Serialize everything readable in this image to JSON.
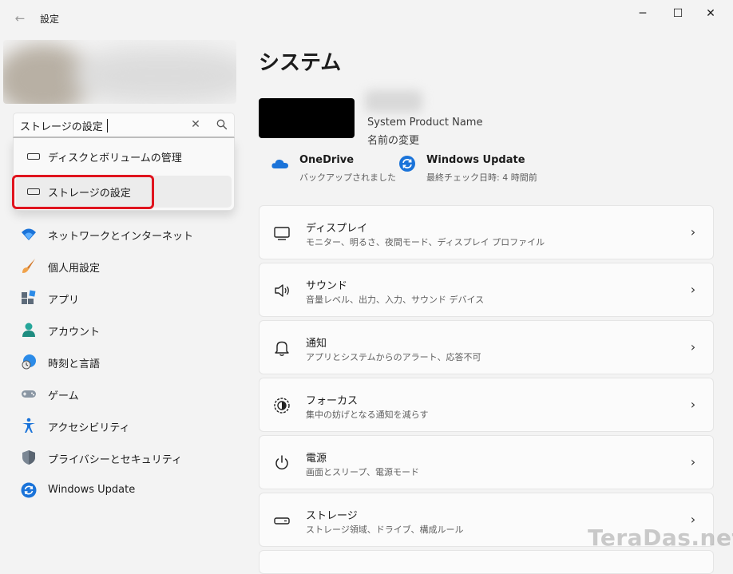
{
  "window": {
    "title": "設定",
    "back_glyph": "←",
    "minimize_glyph": "─",
    "maximize_glyph": "☐",
    "close_glyph": "✕"
  },
  "search": {
    "value": "ストレージの設定",
    "clear_glyph": "✕",
    "suggestions": [
      {
        "label": "ディスクとボリュームの管理",
        "icon": "storage-icon"
      },
      {
        "label": "ストレージの設定",
        "icon": "storage-icon",
        "highlighted": true
      }
    ]
  },
  "sidebar": {
    "items": [
      {
        "label": "ネットワークとインターネット",
        "icon": "wifi-icon"
      },
      {
        "label": "個人用設定",
        "icon": "brush-icon"
      },
      {
        "label": "アプリ",
        "icon": "apps-icon"
      },
      {
        "label": "アカウント",
        "icon": "person-icon"
      },
      {
        "label": "時刻と言語",
        "icon": "globe-clock-icon"
      },
      {
        "label": "ゲーム",
        "icon": "gamepad-icon"
      },
      {
        "label": "アクセシビリティ",
        "icon": "accessibility-icon"
      },
      {
        "label": "プライバシーとセキュリティ",
        "icon": "shield-icon"
      },
      {
        "label": "Windows Update",
        "icon": "update-icon"
      }
    ]
  },
  "main": {
    "title": "システム",
    "device": {
      "name": "System Product Name",
      "rename_label": "名前の変更"
    },
    "status": [
      {
        "title": "OneDrive",
        "subtitle": "バックアップされました",
        "icon": "cloud-icon"
      },
      {
        "title": "Windows Update",
        "subtitle": "最終チェック日時: 4 時間前",
        "icon": "update-icon"
      }
    ],
    "cards": [
      {
        "title": "ディスプレイ",
        "subtitle": "モニター、明るさ、夜間モード、ディスプレイ プロファイル",
        "icon": "monitor-icon"
      },
      {
        "title": "サウンド",
        "subtitle": "音量レベル、出力、入力、サウンド デバイス",
        "icon": "speaker-icon"
      },
      {
        "title": "通知",
        "subtitle": "アプリとシステムからのアラート、応答不可",
        "icon": "bell-icon"
      },
      {
        "title": "フォーカス",
        "subtitle": "集中の妨げとなる通知を減らす",
        "icon": "focus-icon"
      },
      {
        "title": "電源",
        "subtitle": "画面とスリープ、電源モード",
        "icon": "power-icon"
      },
      {
        "title": "ストレージ",
        "subtitle": "ストレージ領域、ドライブ、構成ルール",
        "icon": "storage-icon"
      }
    ],
    "chevron_glyph": "›"
  },
  "watermark": "TeraDas.net",
  "colors": {
    "accent": "#0067c0",
    "highlight_border": "#e0141e",
    "background": "#f3f3f3"
  }
}
